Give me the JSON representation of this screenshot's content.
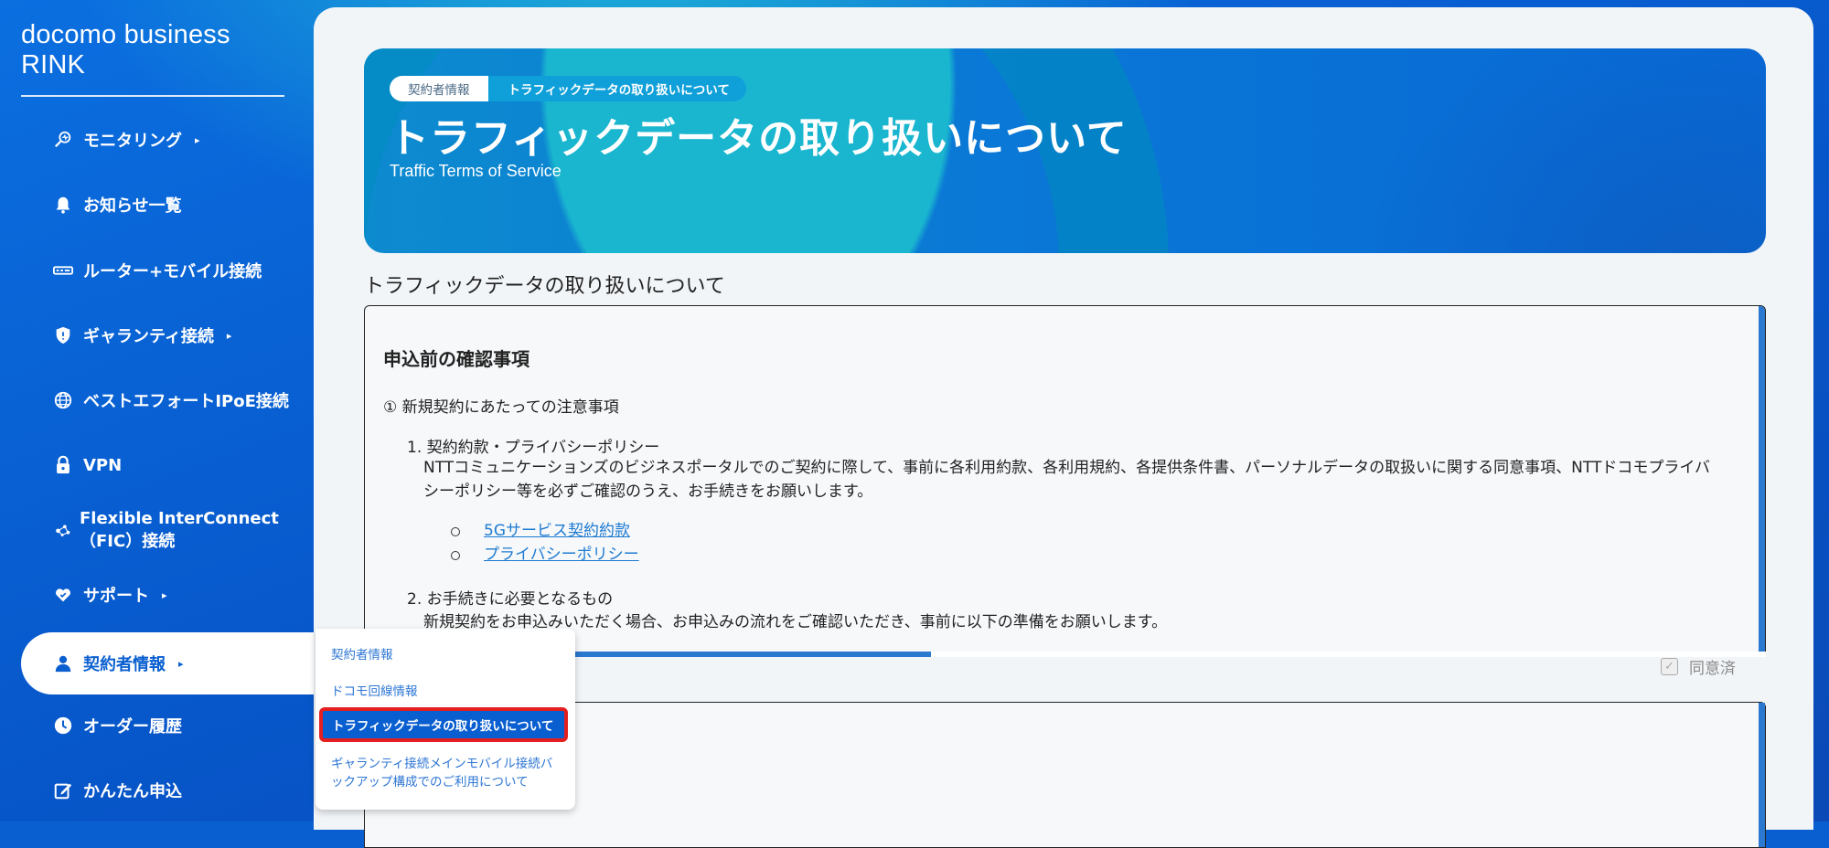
{
  "brand": "docomo business RINK",
  "sidebar": {
    "items": [
      {
        "label": "モニタリング",
        "icon": "monitoring-icon",
        "arrow": "▸"
      },
      {
        "label": "お知らせ一覧",
        "icon": "bell-icon"
      },
      {
        "label": "ルーター+モバイル接続",
        "icon": "router-icon"
      },
      {
        "label": "ギャランティ接続",
        "icon": "shield-icon",
        "arrow": "▸"
      },
      {
        "label": "ベストエフォートIPoE接続",
        "icon": "globe-icon"
      },
      {
        "label": "VPN",
        "icon": "lock-icon"
      },
      {
        "label_line1": "Flexible InterConnect",
        "label_line2": "（FIC）接続",
        "icon": "network-icon"
      },
      {
        "label": "サポート",
        "icon": "support-icon",
        "arrow": "▸"
      },
      {
        "label": "契約者情報",
        "icon": "user-icon",
        "arrow": "▸"
      },
      {
        "label": "オーダー履歴",
        "icon": "clock-icon"
      },
      {
        "label": "かんたん申込",
        "icon": "edit-icon"
      }
    ]
  },
  "submenu": {
    "items": [
      {
        "label": "契約者情報"
      },
      {
        "label": "ドコモ回線情報"
      },
      {
        "label": "トラフィックデータの取り扱いについて"
      },
      {
        "label_line1": "ギャランティ接続メインモバイル接続バ",
        "label_line2": "ックアップ構成でのご利用について"
      }
    ]
  },
  "breadcrumb": {
    "parent": "契約者情報",
    "current": "トラフィックデータの取り扱いについて"
  },
  "hero": {
    "title": "トラフィックデータの取り扱いについて",
    "subtitle": "Traffic Terms of Service"
  },
  "section_title": "トラフィックデータの取り扱いについて",
  "terms": {
    "heading": "申込前の確認事項",
    "section1": "① 新規契約にあたっての注意事項",
    "item1_title": "1. 契約約款・プライバシーポリシー",
    "item1_body": "NTTコミュニケーションズのビジネスポータルでのご契約に際して、事前に各利用約款、各利用規約、各提供条件書、パーソナルデータの取扱いに関する同意事項、NTTドコモプライバシーポリシー等を必ずご確認のうえ、お手続きをお願いします。",
    "link1": "5Gサービス契約約款",
    "link2": "プライバシーポリシー",
    "item2_title": "2. お手続きに必要となるもの",
    "item2_body": "新規契約をお申込みいただく場合、お申込みの流れをご確認いただき、事前に以下の準備をお願いします。"
  },
  "agree_label": "同意済",
  "colors": {
    "brand_blue": "#0a5fd0",
    "link": "#1f7bd1",
    "highlight_border": "#e31f1f"
  }
}
